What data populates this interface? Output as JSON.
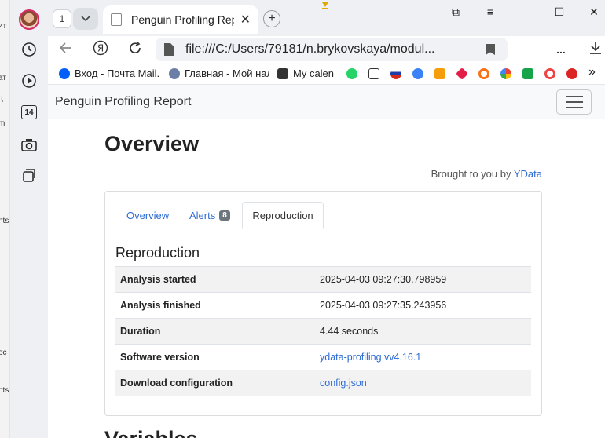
{
  "left_strip": {
    "fragments": [
      "ит",
      "ат",
      "ц",
      "m",
      "nts",
      "ос",
      "nts"
    ]
  },
  "browser": {
    "tab_count": "1",
    "tab_title": "Penguin Profiling Report",
    "tab_close": "✕",
    "new_tab": "+",
    "window_controls": {
      "minimize": "—",
      "maximize": "☐",
      "close": "✕",
      "menu": "≡",
      "ext": "⧉"
    },
    "url": "file:///C:/Users/79181/n.brykovskaya/modul...",
    "more": "...",
    "sidebar_badge": "14",
    "bookmarks": [
      {
        "label": "Вход - Почта Mail.",
        "color": "#005ff9"
      },
      {
        "label": "Главная - Мой нал",
        "color": "#6b7fa6"
      },
      {
        "label": "My calen",
        "color": "#333333"
      }
    ],
    "bookmark_icon_colors": [
      "#25d366",
      "#ffffff",
      "#d52b1e",
      "#3b82f6",
      "#f59e0b",
      "#e11d48",
      "#f97316",
      "#4285f4",
      "#16a34a",
      "#ef4444",
      "#dc2626"
    ],
    "bookmarks_more": "»"
  },
  "page": {
    "brand": "Penguin Profiling Report",
    "overview_heading": "Overview",
    "brought_text": "Brought to you by ",
    "brought_link": "YData",
    "tabs": {
      "overview": "Overview",
      "alerts": "Alerts",
      "alerts_badge": "8",
      "reproduction": "Reproduction"
    },
    "reproduction": {
      "heading": "Reproduction",
      "rows": [
        {
          "key": "Analysis started",
          "value": "2025-04-03 09:27:30.798959"
        },
        {
          "key": "Analysis finished",
          "value": "2025-04-03 09:27:35.243956"
        },
        {
          "key": "Duration",
          "value": "4.44 seconds"
        },
        {
          "key": "Software version",
          "value": "ydata-profiling vv4.16.1"
        },
        {
          "key": "Download configuration",
          "value": "config.json"
        }
      ]
    },
    "variables_heading": "Variables"
  }
}
